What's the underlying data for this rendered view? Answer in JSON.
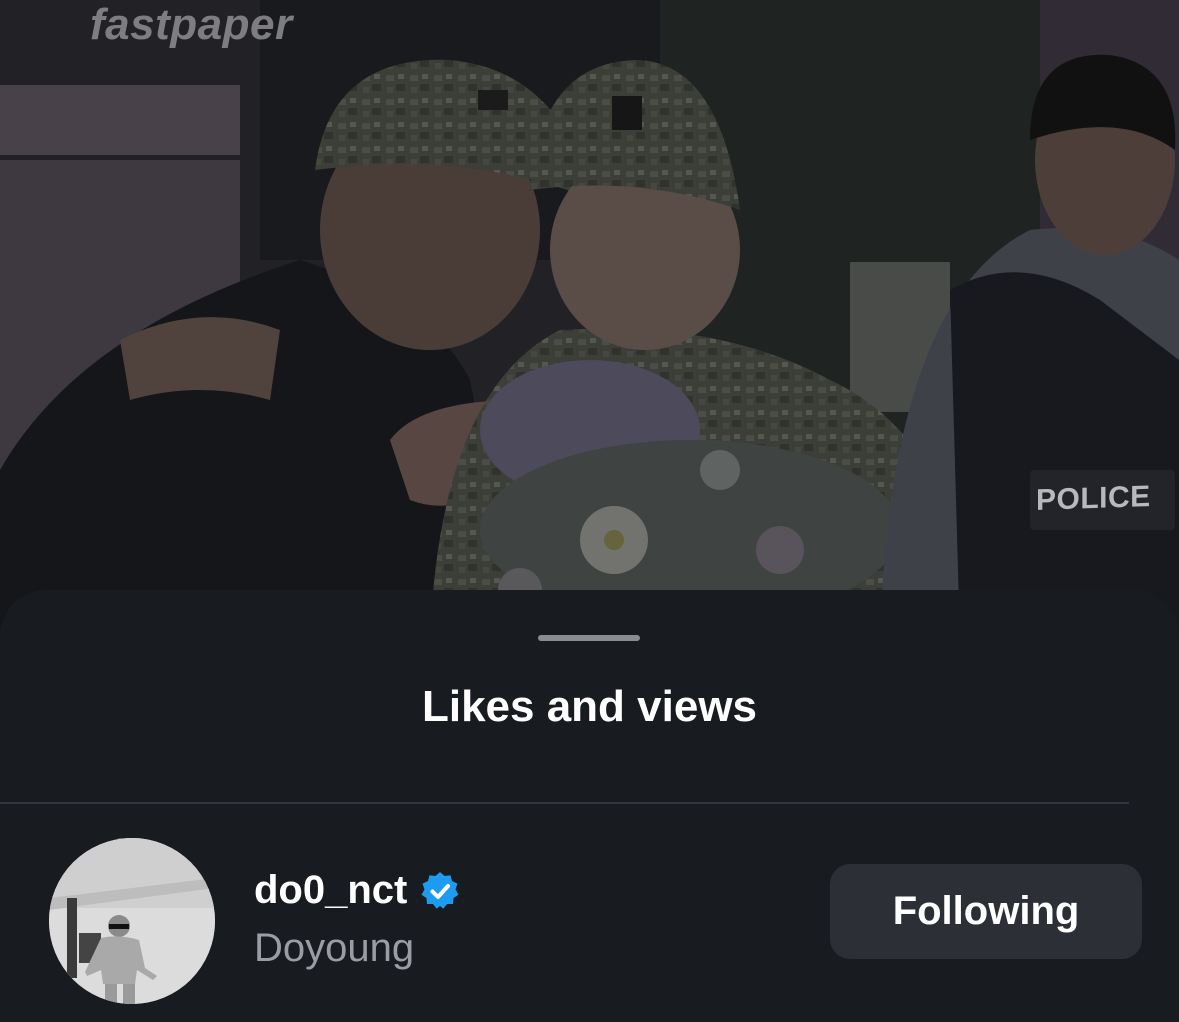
{
  "background_photo": {
    "watermark": "fastpaper",
    "vest_text": "POLICE"
  },
  "sheet": {
    "title": "Likes and views"
  },
  "user": {
    "username": "do0_nct",
    "display_name": "Doyoung",
    "verified": true,
    "follow_button_label": "Following"
  },
  "colors": {
    "sheet_background": "#181b20",
    "button_background": "#2c2f36",
    "verified_blue": "#1d9bf0",
    "secondary_text": "#9a9da3"
  }
}
